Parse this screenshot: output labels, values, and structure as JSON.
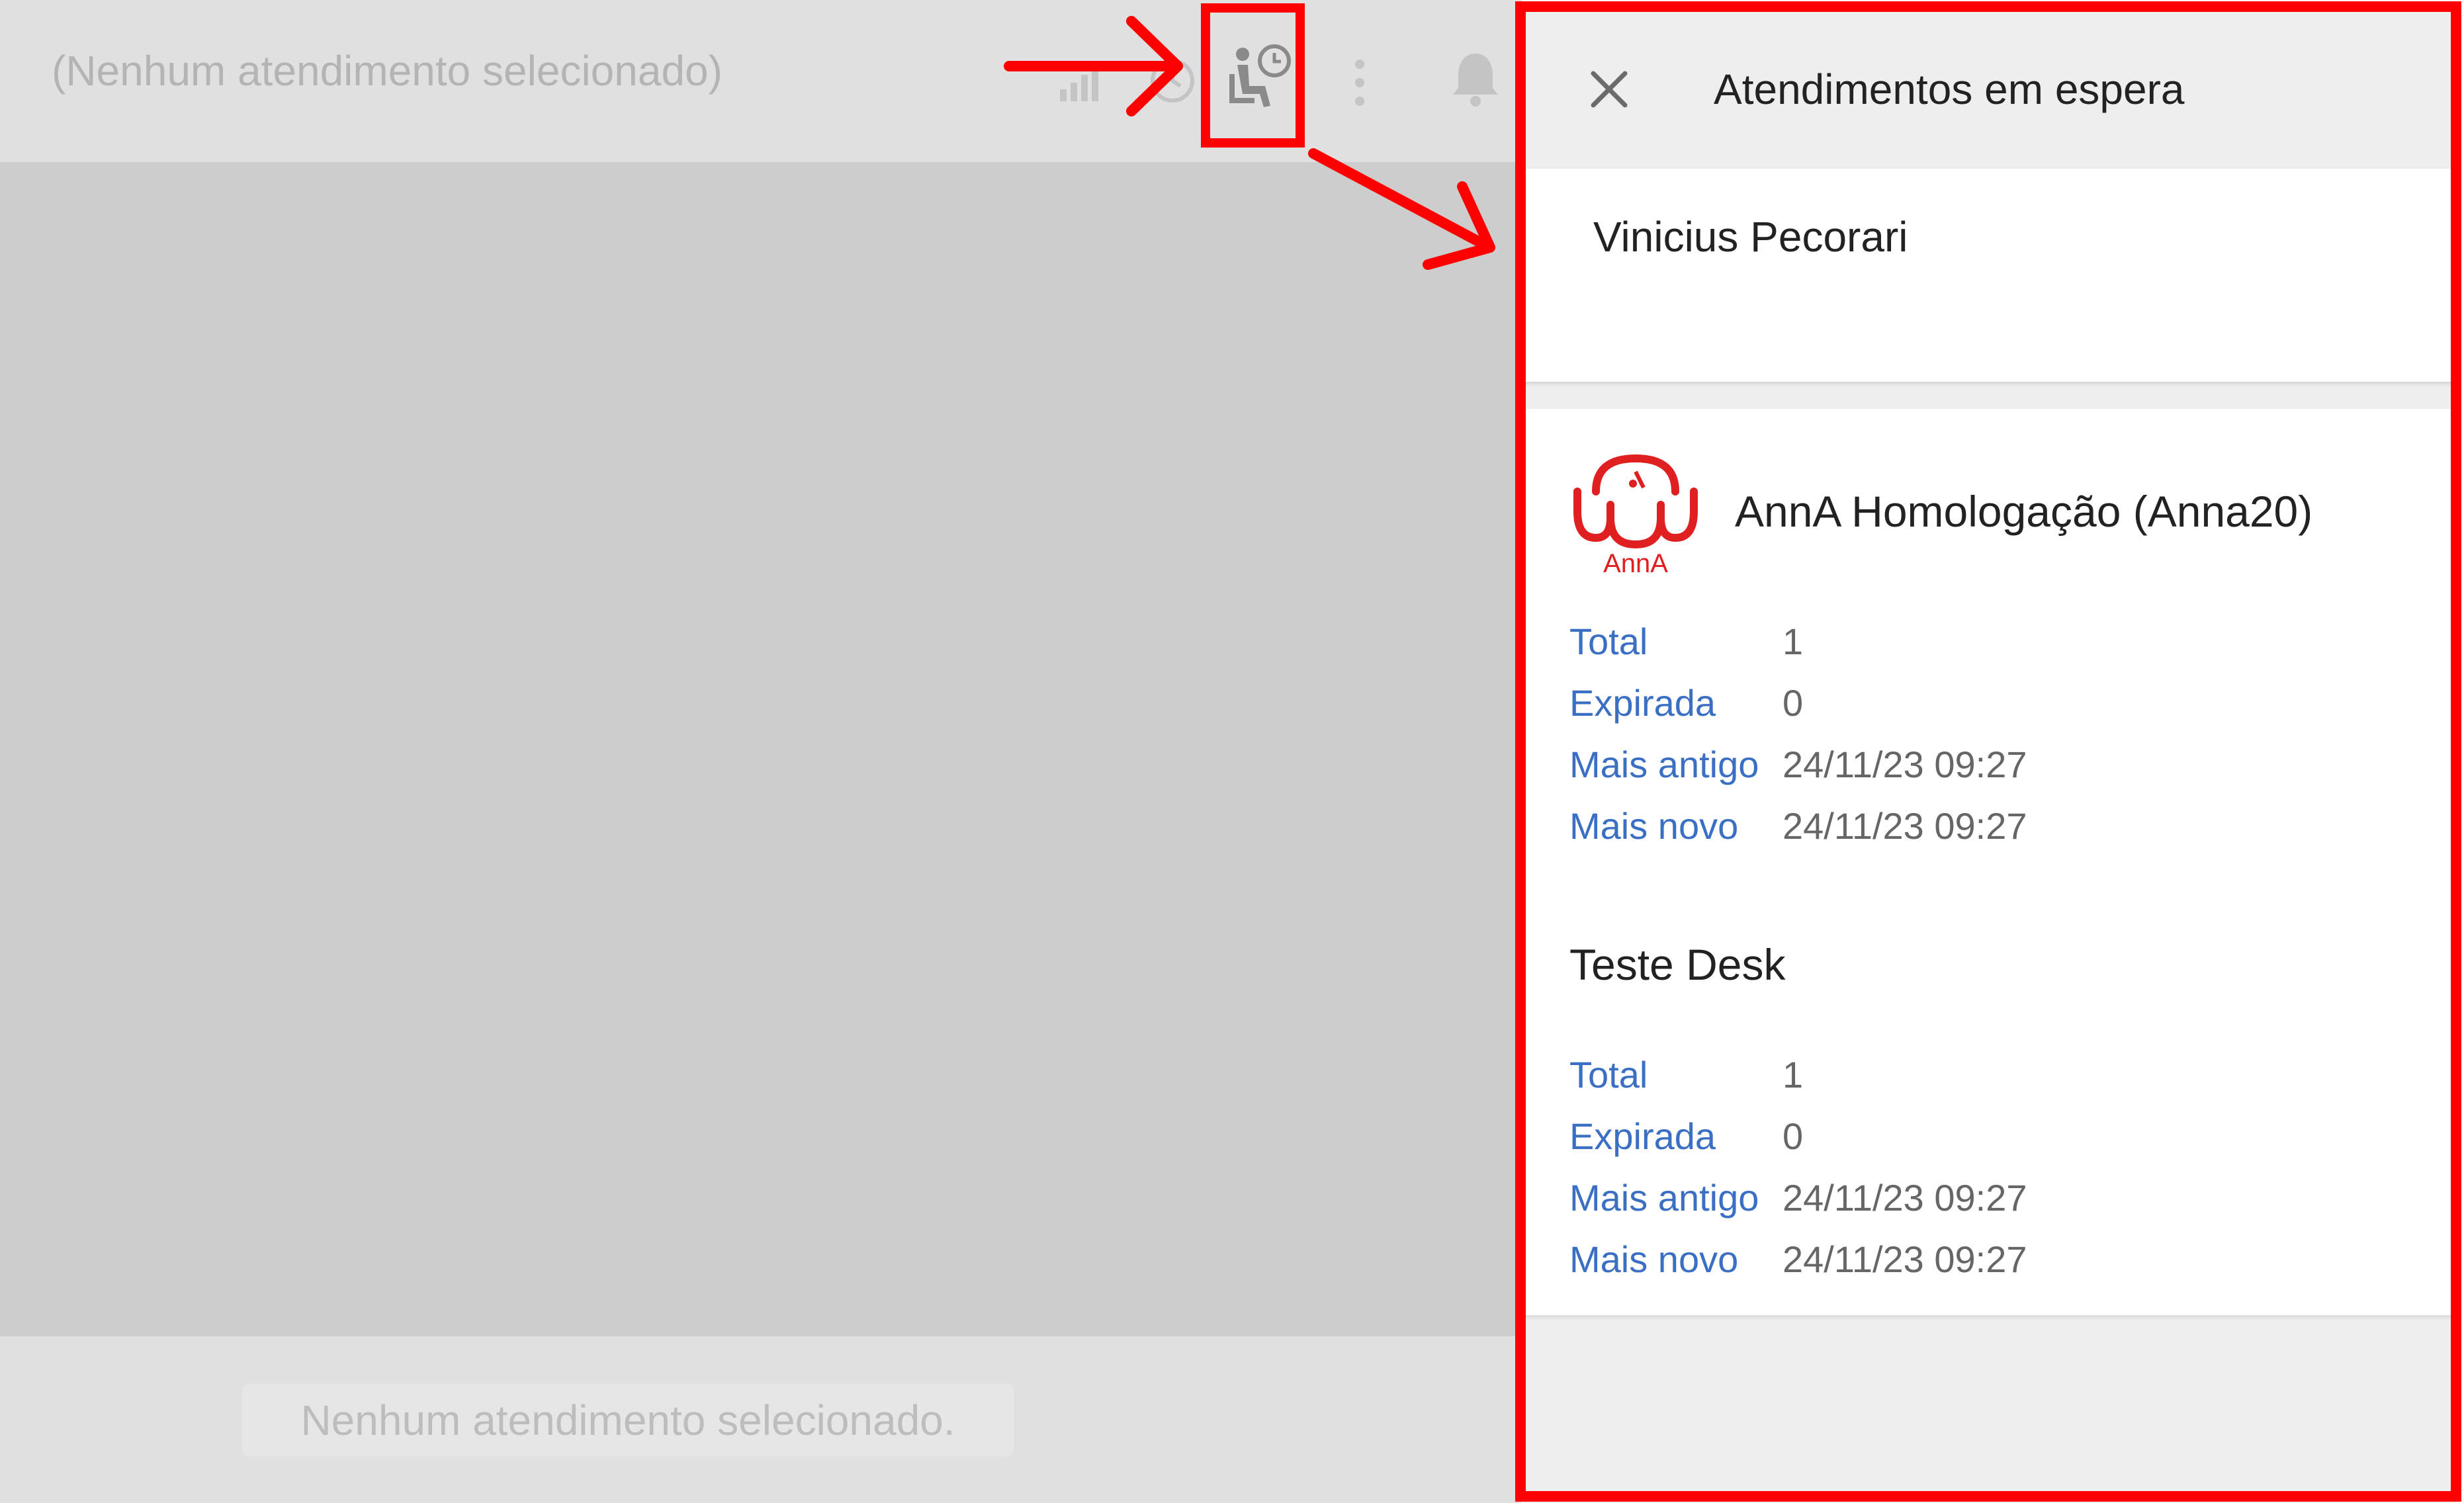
{
  "chat": {
    "header_title": "(Nenhum atendimento selecionado)",
    "empty_message": "Nenhum atendimento selecionado."
  },
  "icons": {
    "signal": "signal-icon",
    "clock": "clock-icon",
    "waiting": "waiting-queue-icon",
    "more": "more-vertical-icon",
    "bell": "bell-icon",
    "close": "close-icon"
  },
  "panel": {
    "title": "Atendimentos em espera",
    "user_name": "Vinicius Pecorari",
    "queues": [
      {
        "name": "AnnA Homologação (Anna20)",
        "logo_text": "AnnA",
        "stats": [
          {
            "label": "Total",
            "value": "1"
          },
          {
            "label": "Expirada",
            "value": "0"
          },
          {
            "label": "Mais antigo",
            "value": "24/11/23 09:27"
          },
          {
            "label": "Mais novo",
            "value": "24/11/23 09:27"
          }
        ]
      },
      {
        "name": "Teste Desk",
        "stats": [
          {
            "label": "Total",
            "value": "1"
          },
          {
            "label": "Expirada",
            "value": "0"
          },
          {
            "label": "Mais antigo",
            "value": "24/11/23 09:27"
          },
          {
            "label": "Mais novo",
            "value": "24/11/23 09:27"
          }
        ]
      }
    ]
  },
  "colors": {
    "annotation": "#ff0000",
    "stat_label": "#3a6fc4",
    "logo": "#e02020"
  }
}
